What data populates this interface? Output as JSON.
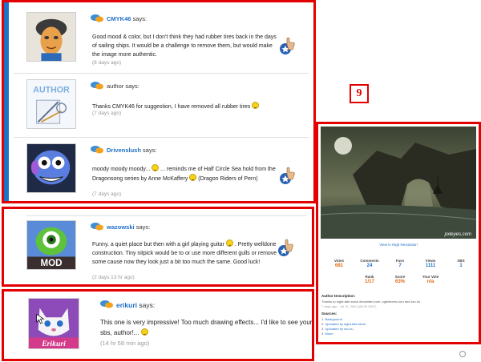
{
  "panel_a": {
    "comments": [
      {
        "user": "CMYK46",
        "says": "says:",
        "text": "Good mood & color, but I don't think they had rubber tires back in the days of sailing ships. It would be a challenge to remove them, but would make the image more authentic.",
        "time": "(8 days ago)",
        "avatar": "cmyk46-avatar"
      },
      {
        "user": "author",
        "says": "says:",
        "text": "Thanks CMYK46 for suggestion, I have removed all rubber tires",
        "time": "(7 days ago)",
        "avatar_label": "AUTHOR"
      },
      {
        "user": "Drivenslush",
        "says": "says:",
        "text_part1": "moody moody moody...",
        "text_part2": "... reminds me of Half Circle Sea hold from the Dragonsong series by Anne McKaffery",
        "text_part3": "(Dragon Riders of Pern)",
        "time": "(7 days ago)"
      }
    ]
  },
  "panel_b": {
    "user": "wazowski",
    "says": "says:",
    "text_part1": "Funny, a quiet place but then with a girl playing guitar",
    "text_part2": ". Pretty welldone construction. Tiny nitpick would be to or use more different gulls or remove some cause now they look just a bit too much the same. Good luck!",
    "time": "(2 days 13 hr ago)",
    "avatar_label": "MOD"
  },
  "panel_c": {
    "user": "erikuri",
    "says": "says:",
    "text": "This one is very impressive! Too much drawing effects... I'd like to see your sbs, author!...",
    "time": "(14 hr 58 min ago)",
    "avatar_label": "Erikuri"
  },
  "badge": "9",
  "side_panel": {
    "credit": "pxleyes.com",
    "hi_res": "View in High Resolution",
    "stats_row1": [
      {
        "label": "Votes",
        "value": "681",
        "color": "orange"
      },
      {
        "label": "Comments",
        "value": "24",
        "color": "blue"
      },
      {
        "label": "Favs",
        "value": "7",
        "color": "blue"
      },
      {
        "label": "Views",
        "value": "1111",
        "color": "blue"
      },
      {
        "label": "SBS",
        "value": "1",
        "color": "blue"
      }
    ],
    "stats_row2": [
      {
        "label": "Rank",
        "value": "1/17",
        "color": "orange"
      },
      {
        "label": "Score",
        "value": "63%",
        "color": "orange"
      },
      {
        "label": "Your Vote",
        "value": "n/a",
        "color": "orange"
      }
    ],
    "author_desc_title": "Author Description:",
    "author_desc": "Thanks to night-fate-stock.deviantart.com, cgtextures.com and sxc.hu",
    "author_date": "7 days ago - Jul 11, 2010 (06:00 GMT)",
    "sources_title": "Sources:",
    "sources": [
      {
        "prefix": "1.",
        "link": "Background"
      },
      {
        "prefix": "2.",
        "link": "Uploaded by night-fate-stock"
      },
      {
        "prefix": "3.",
        "link": "Uploaded by sxc.hu"
      },
      {
        "prefix": "4.",
        "link": "Moon"
      }
    ]
  },
  "colors": {
    "frame_red": "#e30000",
    "username_blue": "#1e6fc7",
    "stat_orange": "#e56a12",
    "left_bar_blue": "#1c74c9"
  }
}
